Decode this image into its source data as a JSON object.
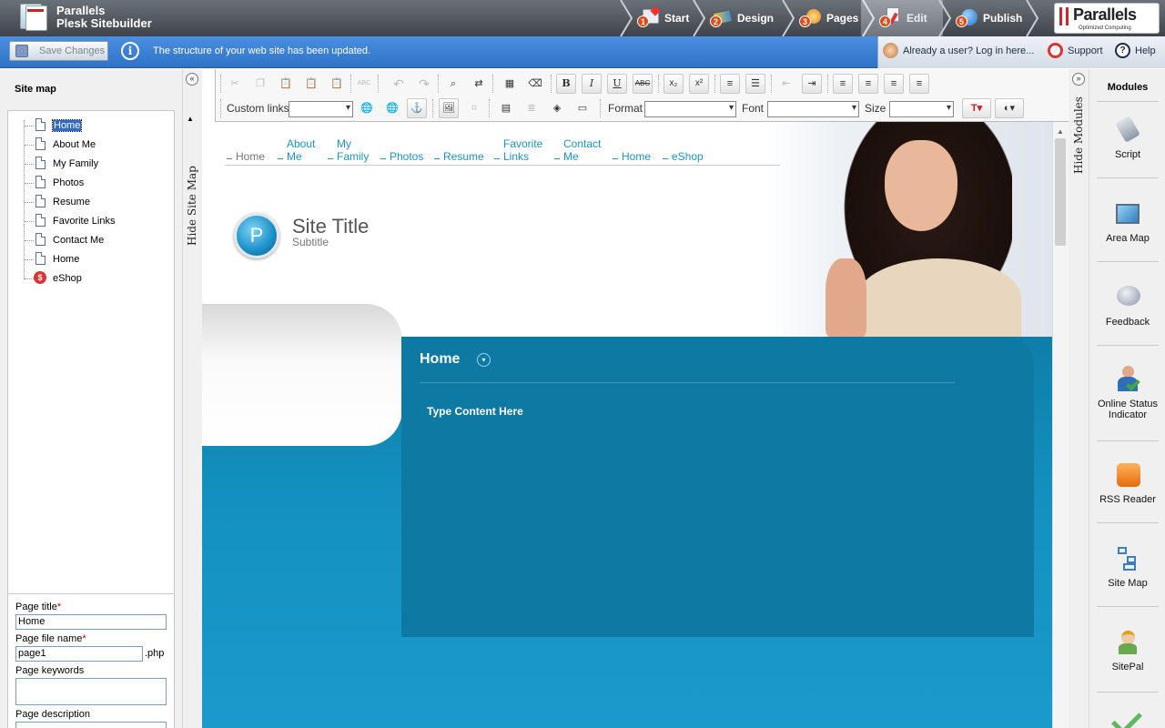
{
  "app": {
    "brand_line1": "Parallels",
    "brand_line2": "Plesk Sitebuilder"
  },
  "steps": [
    {
      "num": "1",
      "label": "Start"
    },
    {
      "num": "2",
      "label": "Design"
    },
    {
      "num": "3",
      "label": "Pages"
    },
    {
      "num": "4",
      "label": "Edit"
    },
    {
      "num": "5",
      "label": "Publish"
    }
  ],
  "vendor": {
    "name": "Parallels",
    "tagline": "Optimized Computing"
  },
  "message_bar": {
    "save_label": "Save Changes",
    "info_glyph": "i",
    "message": "The structure of your web site has been updated.",
    "login_link": "Already a user? Log in here...",
    "support_link": "Support",
    "help_link": "Help",
    "help_glyph": "?"
  },
  "sitemap": {
    "title": "Site map",
    "hide_label": "Hide Site Map",
    "items": [
      "Home",
      "About Me",
      "My Family",
      "Photos",
      "Resume",
      "Favorite Links",
      "Contact Me",
      "Home",
      "eShop"
    ],
    "shop_glyph": "$"
  },
  "props": {
    "title_label": "Page title",
    "title_value": "Home",
    "file_label": "Page file name",
    "file_value": "page1",
    "file_ext": ".php",
    "keywords_label": "Page keywords",
    "description_label": "Page description",
    "required_mark": "*"
  },
  "toolbar": {
    "custom_links_label": "Custom links",
    "format_label": "Format",
    "font_label": "Font",
    "size_label": "Size",
    "icons": {
      "bold": "B",
      "italic": "I",
      "underline": "U",
      "strike": "ABC",
      "subscript": "x₂",
      "superscript": "x²",
      "undo": "↶",
      "redo": "↷",
      "cut": "✂",
      "spell": "ABC"
    }
  },
  "site": {
    "nav": [
      {
        "label": "Home"
      },
      {
        "label": "About\nMe"
      },
      {
        "label": "My\nFamily"
      },
      {
        "label": "Photos"
      },
      {
        "label": "Resume"
      },
      {
        "label": "Favorite\nLinks"
      },
      {
        "label": "Contact\nMe"
      },
      {
        "label": "Home"
      },
      {
        "label": "eShop"
      }
    ],
    "logo_letter": "P",
    "title": "Site Title",
    "subtitle": "Subtitle",
    "page_heading": "Home",
    "page_content": "Type Content Here"
  },
  "modules": {
    "title": "Modules",
    "hide_label": "Hide Modules",
    "items": [
      "Script",
      "Area Map",
      "Feedback",
      "Online Status Indicator",
      "RSS Reader",
      "Site Map",
      "SitePal"
    ]
  },
  "colors": {
    "accent_blue": "#1a95c9",
    "content_blue": "#0e79a3",
    "topbar": "#4a5057"
  }
}
